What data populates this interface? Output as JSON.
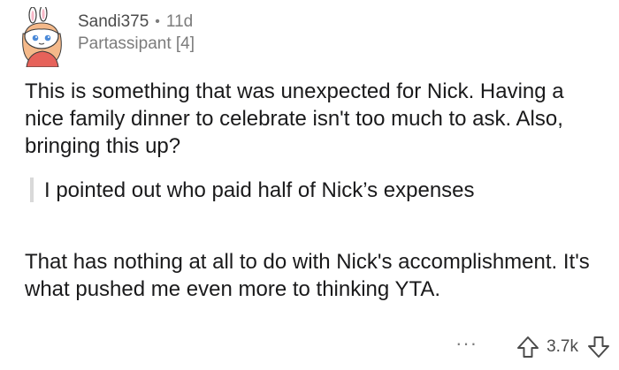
{
  "comment": {
    "username": "Sandi375",
    "separator": "•",
    "age": "11d",
    "flair": "Partassipant [4]",
    "paragraph1": "This is something that was unexpected for Nick. Having a nice family dinner to celebrate isn't too much to ask. Also, bringing this up?",
    "quote": "I pointed out who paid half of Nick’s expenses",
    "paragraph2": "That has nothing at all to do with Nick's accomplishment. It's what pushed me even more to thinking YTA.",
    "more_label": "···",
    "score": "3.7k"
  },
  "colors": {
    "text": "#1a1a1b",
    "meta": "#7c7c7c",
    "quote_bar": "#d9d9d9",
    "avatar_hair": "#f4b98a",
    "avatar_shirt": "#e6625a"
  },
  "icons": {
    "avatar": "snoo-avatar",
    "upvote": "upvote-arrow-icon",
    "downvote": "downvote-arrow-icon",
    "more": "more-options-icon"
  }
}
